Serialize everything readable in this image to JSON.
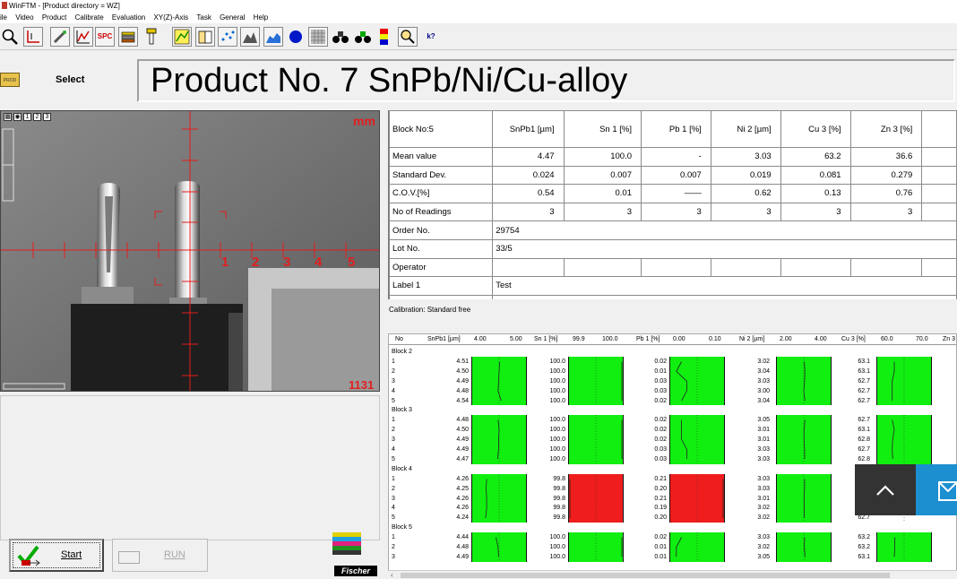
{
  "window": {
    "title": "WinFTM - [Product directory = WZ]"
  },
  "menu": {
    "items": [
      "ile",
      "Video",
      "Product",
      "Calibrate",
      "Evaluation",
      "XY(Z)-Axis",
      "Task",
      "General",
      "Help"
    ]
  },
  "toolbar": {
    "icons": [
      "magnifier-icon",
      "thickness-icon",
      "measure-tool-icon",
      "chart-icon",
      "spc-icon",
      "stack-icon",
      "probe-icon",
      "graph-icon",
      "book-icon",
      "scatter-icon",
      "mountain-icon",
      "area-icon",
      "dot-icon",
      "pattern-icon",
      "binoculars-icon",
      "binoculars-2-icon",
      "color-bar-icon",
      "zoom-icon",
      "help-icon"
    ],
    "spc_label": "SPC",
    "help_label": "k?"
  },
  "select": {
    "label": "Select"
  },
  "product": {
    "title": "Product No. 7  SnPb/Ni/Cu-alloy"
  },
  "camera": {
    "unit_label": "mm",
    "scale": [
      "1",
      "2",
      "3",
      "4",
      "5"
    ],
    "value": "1131",
    "view_buttons": [
      "1",
      "2",
      "3"
    ]
  },
  "summary": {
    "columns": [
      "Block No:5",
      "SnPb1 [µm]",
      "Sn 1 [%]",
      "Pb 1 [%]",
      "Ni 2 [µm]",
      "Cu 3 [%]",
      "Zn 3 [%]"
    ],
    "stats": [
      {
        "label": "Mean value",
        "values": [
          "4.47",
          "100.0",
          "-",
          "3.03",
          "63.2",
          "36.6"
        ]
      },
      {
        "label": "Standard Dev.",
        "values": [
          "0.024",
          "0.007",
          "0.007",
          "0.019",
          "0.081",
          "0.279"
        ]
      },
      {
        "label": "C.O.V.[%]",
        "values": [
          "0.54",
          "0.01",
          "——",
          "0.62",
          "0.13",
          "0.76"
        ]
      },
      {
        "label": "No of Readings",
        "values": [
          "3",
          "3",
          "3",
          "3",
          "3",
          "3"
        ]
      }
    ],
    "info": [
      {
        "label": "Order No.",
        "value": "29754"
      },
      {
        "label": "Lot No.",
        "value": "33/5"
      },
      {
        "label": "Operator",
        "value": ""
      },
      {
        "label": "Label 1",
        "value": "Test"
      }
    ]
  },
  "calibration": {
    "text": "Calibration: Standard free"
  },
  "detail": {
    "header": {
      "no": "No",
      "snpb": "SnPb1 [µm]",
      "snpb_min": "4.00",
      "snpb_max": "5.00",
      "sn": "Sn 1 [%]",
      "sn_min": "99.9",
      "sn_max": "100.0",
      "pb": "Pb 1 [%]",
      "pb_min": "0.00",
      "pb_max": "0.10",
      "ni": "Ni 2 [µm]",
      "ni_min": "2.00",
      "ni_max": "4.00",
      "cu": "Cu 3 [%]",
      "cu_min": "60.0",
      "cu_max": "70.0",
      "zn": "Zn 3"
    },
    "blocks": [
      {
        "label": "Block 2",
        "red": false,
        "rows": [
          [
            "1",
            "4.51",
            "100.0",
            "0.02",
            "3.02",
            "63.1"
          ],
          [
            "2",
            "4.50",
            "100.0",
            "0.01",
            "3.04",
            "63.1"
          ],
          [
            "3",
            "4.49",
            "100.0",
            "0.03",
            "3.03",
            "62.7"
          ],
          [
            "4",
            "4.48",
            "100.0",
            "0.03",
            "3.00",
            "62.7"
          ],
          [
            "5",
            "4.54",
            "100.0",
            "0.02",
            "3.04",
            "62.7"
          ]
        ]
      },
      {
        "label": "Block 3",
        "red": false,
        "rows": [
          [
            "1",
            "4.48",
            "100.0",
            "0.02",
            "3.05",
            "62.7"
          ],
          [
            "2",
            "4.50",
            "100.0",
            "0.02",
            "3.01",
            "63.1"
          ],
          [
            "3",
            "4.49",
            "100.0",
            "0.02",
            "3.01",
            "62.8"
          ],
          [
            "4",
            "4.49",
            "100.0",
            "0.03",
            "3.03",
            "62.7"
          ],
          [
            "5",
            "4.47",
            "100.0",
            "0.03",
            "3.03",
            "62.8"
          ]
        ]
      },
      {
        "label": "Block 4",
        "red": true,
        "rows": [
          [
            "1",
            "4.26",
            "99.8",
            "0.21",
            "3.03",
            ""
          ],
          [
            "2",
            "4.25",
            "99.8",
            "0.20",
            "3.03",
            ""
          ],
          [
            "3",
            "4.26",
            "99.8",
            "0.21",
            "3.01",
            ""
          ],
          [
            "4",
            "4.26",
            "99.8",
            "0.19",
            "3.02",
            ""
          ],
          [
            "5",
            "4.24",
            "99.8",
            "0.20",
            "3.02",
            "62.7"
          ]
        ]
      },
      {
        "label": "Block 5",
        "red": false,
        "rows": [
          [
            "1",
            "4.44",
            "100.0",
            "0.02",
            "3.03",
            "63.2"
          ],
          [
            "2",
            "4.48",
            "100.0",
            "0.01",
            "3.02",
            "63.2"
          ],
          [
            "3",
            "4.49",
            "100.0",
            "0.01",
            "3.05",
            "63.1"
          ]
        ]
      }
    ]
  },
  "buttons": {
    "start": "Start",
    "run": "RUN"
  },
  "logo": {
    "text": "Fischer"
  },
  "colors": {
    "pass": "#10ef10",
    "fail": "#ef1d1d",
    "crosshair": "#e31e1e"
  }
}
